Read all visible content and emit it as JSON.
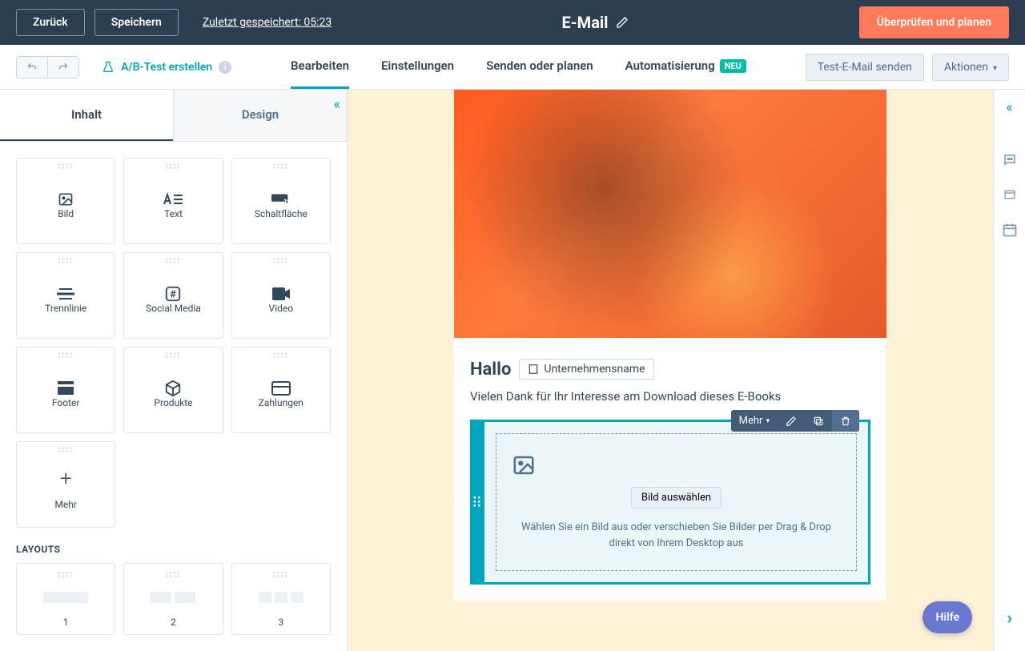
{
  "topbar": {
    "back": "Zurück",
    "save": "Speichern",
    "last_saved": "Zuletzt gespeichert: 05:23",
    "title": "E-Mail",
    "review": "Überprüfen und planen"
  },
  "secondbar": {
    "ab_test": "A/B-Test erstellen",
    "tabs": {
      "edit": "Bearbeiten",
      "settings": "Einstellungen",
      "schedule": "Senden oder planen",
      "automation": "Automatisierung"
    },
    "badge_new": "NEU",
    "send_test": "Test-E-Mail senden",
    "actions": "Aktionen"
  },
  "panel": {
    "tabs": {
      "content": "Inhalt",
      "design": "Design"
    },
    "blocks": {
      "image": "Bild",
      "text": "Text",
      "button": "Schaltfläche",
      "divider": "Trennlinie",
      "social": "Social Media",
      "video": "Video",
      "footer": "Footer",
      "products": "Produkte",
      "payments": "Zahlungen",
      "more": "Mehr"
    },
    "section_layouts": "LAYOUTS",
    "layouts": {
      "one": "1",
      "two": "2",
      "three": "3"
    }
  },
  "email": {
    "greeting": "Hallo",
    "token": "Unternehmensname",
    "body": "Vielen Dank für Ihr Interesse am Download dieses E-Books"
  },
  "module": {
    "more": "Mehr",
    "choose": "Bild auswählen",
    "hint": "Wählen Sie ein Bild aus oder verschieben Sie Bilder per Drag & Drop direkt von Ihrem Desktop aus"
  },
  "help": "Hilfe"
}
